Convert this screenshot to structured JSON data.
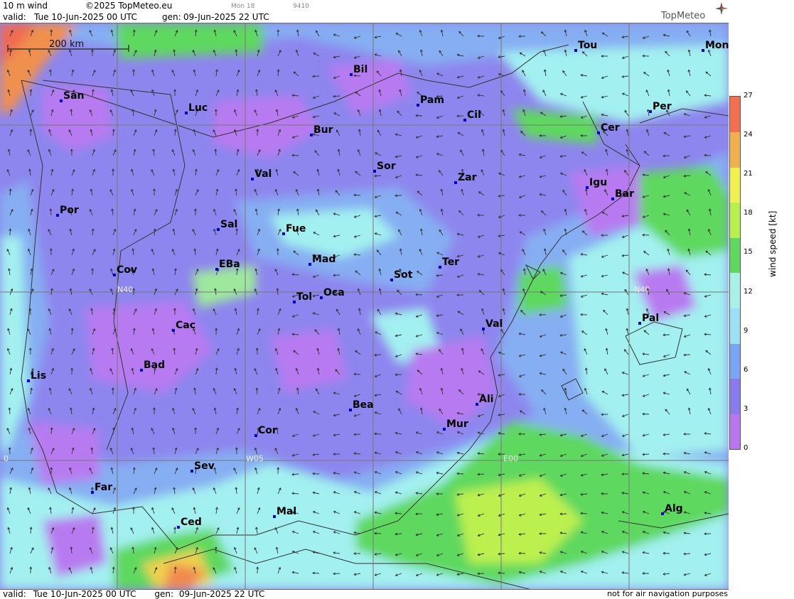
{
  "header": {
    "product": "10 m wind",
    "copyright": "©2025 TopMeteo.eu",
    "valid_label": "valid:",
    "valid_time": "Tue  10-Jun-2025  00 UTC",
    "gen_label": "gen:",
    "gen_time": "09-Jun-2025 22 UTC",
    "run_hint": "Mon 18",
    "code_hint": "9410"
  },
  "logo": {
    "text": "TopMeteo",
    "icon": "compass-star-icon"
  },
  "footer": {
    "valid_label": "valid:",
    "valid_time": "Tue  10-Jun-2025  00 UTC",
    "gen_label": "gen:",
    "gen_time": "09-Jun-2025 22 UTC",
    "disclaimer": "not for air navigation purposes"
  },
  "scale_bar": {
    "label": "200 km"
  },
  "grid_labels": {
    "lat40_left": "N40",
    "lat40_right": "N40",
    "lon_w05": "W05",
    "lon_e00": "E00",
    "lon_w10": "0"
  },
  "legend": {
    "title": "wind speed [kt]",
    "ticks": [
      "27",
      "24",
      "21",
      "18",
      "15",
      "12",
      "9",
      "6",
      "3",
      "0"
    ],
    "colors": [
      "#b877f0",
      "#8a7af0",
      "#7aa4f4",
      "#9be0f4",
      "#a8f0e8",
      "#5ed85e",
      "#b8f050",
      "#f0f050",
      "#f0b050",
      "#f07050"
    ]
  },
  "cities": [
    {
      "name": "Tou"
    },
    {
      "name": "Mon"
    },
    {
      "name": "Bil"
    },
    {
      "name": "San"
    },
    {
      "name": "Pam"
    },
    {
      "name": "Luc"
    },
    {
      "name": "Cil"
    },
    {
      "name": "Per"
    },
    {
      "name": "Bur"
    },
    {
      "name": "Cer"
    },
    {
      "name": "Sor"
    },
    {
      "name": "Val"
    },
    {
      "name": "Zar"
    },
    {
      "name": "Igu"
    },
    {
      "name": "Bar"
    },
    {
      "name": "Por"
    },
    {
      "name": "Sal"
    },
    {
      "name": "Fue"
    },
    {
      "name": "Mad"
    },
    {
      "name": "EBa"
    },
    {
      "name": "Ter"
    },
    {
      "name": "Cov"
    },
    {
      "name": "Sot"
    },
    {
      "name": "Tol"
    },
    {
      "name": "Oca"
    },
    {
      "name": "Pal"
    },
    {
      "name": "Cac"
    },
    {
      "name": "Val"
    },
    {
      "name": "Bad"
    },
    {
      "name": "Lis"
    },
    {
      "name": "Ali"
    },
    {
      "name": "Bea"
    },
    {
      "name": "Mur"
    },
    {
      "name": "Cor"
    },
    {
      "name": "Sev"
    },
    {
      "name": "Far"
    },
    {
      "name": "Alg"
    },
    {
      "name": "Mal"
    },
    {
      "name": "Ced"
    }
  ]
}
